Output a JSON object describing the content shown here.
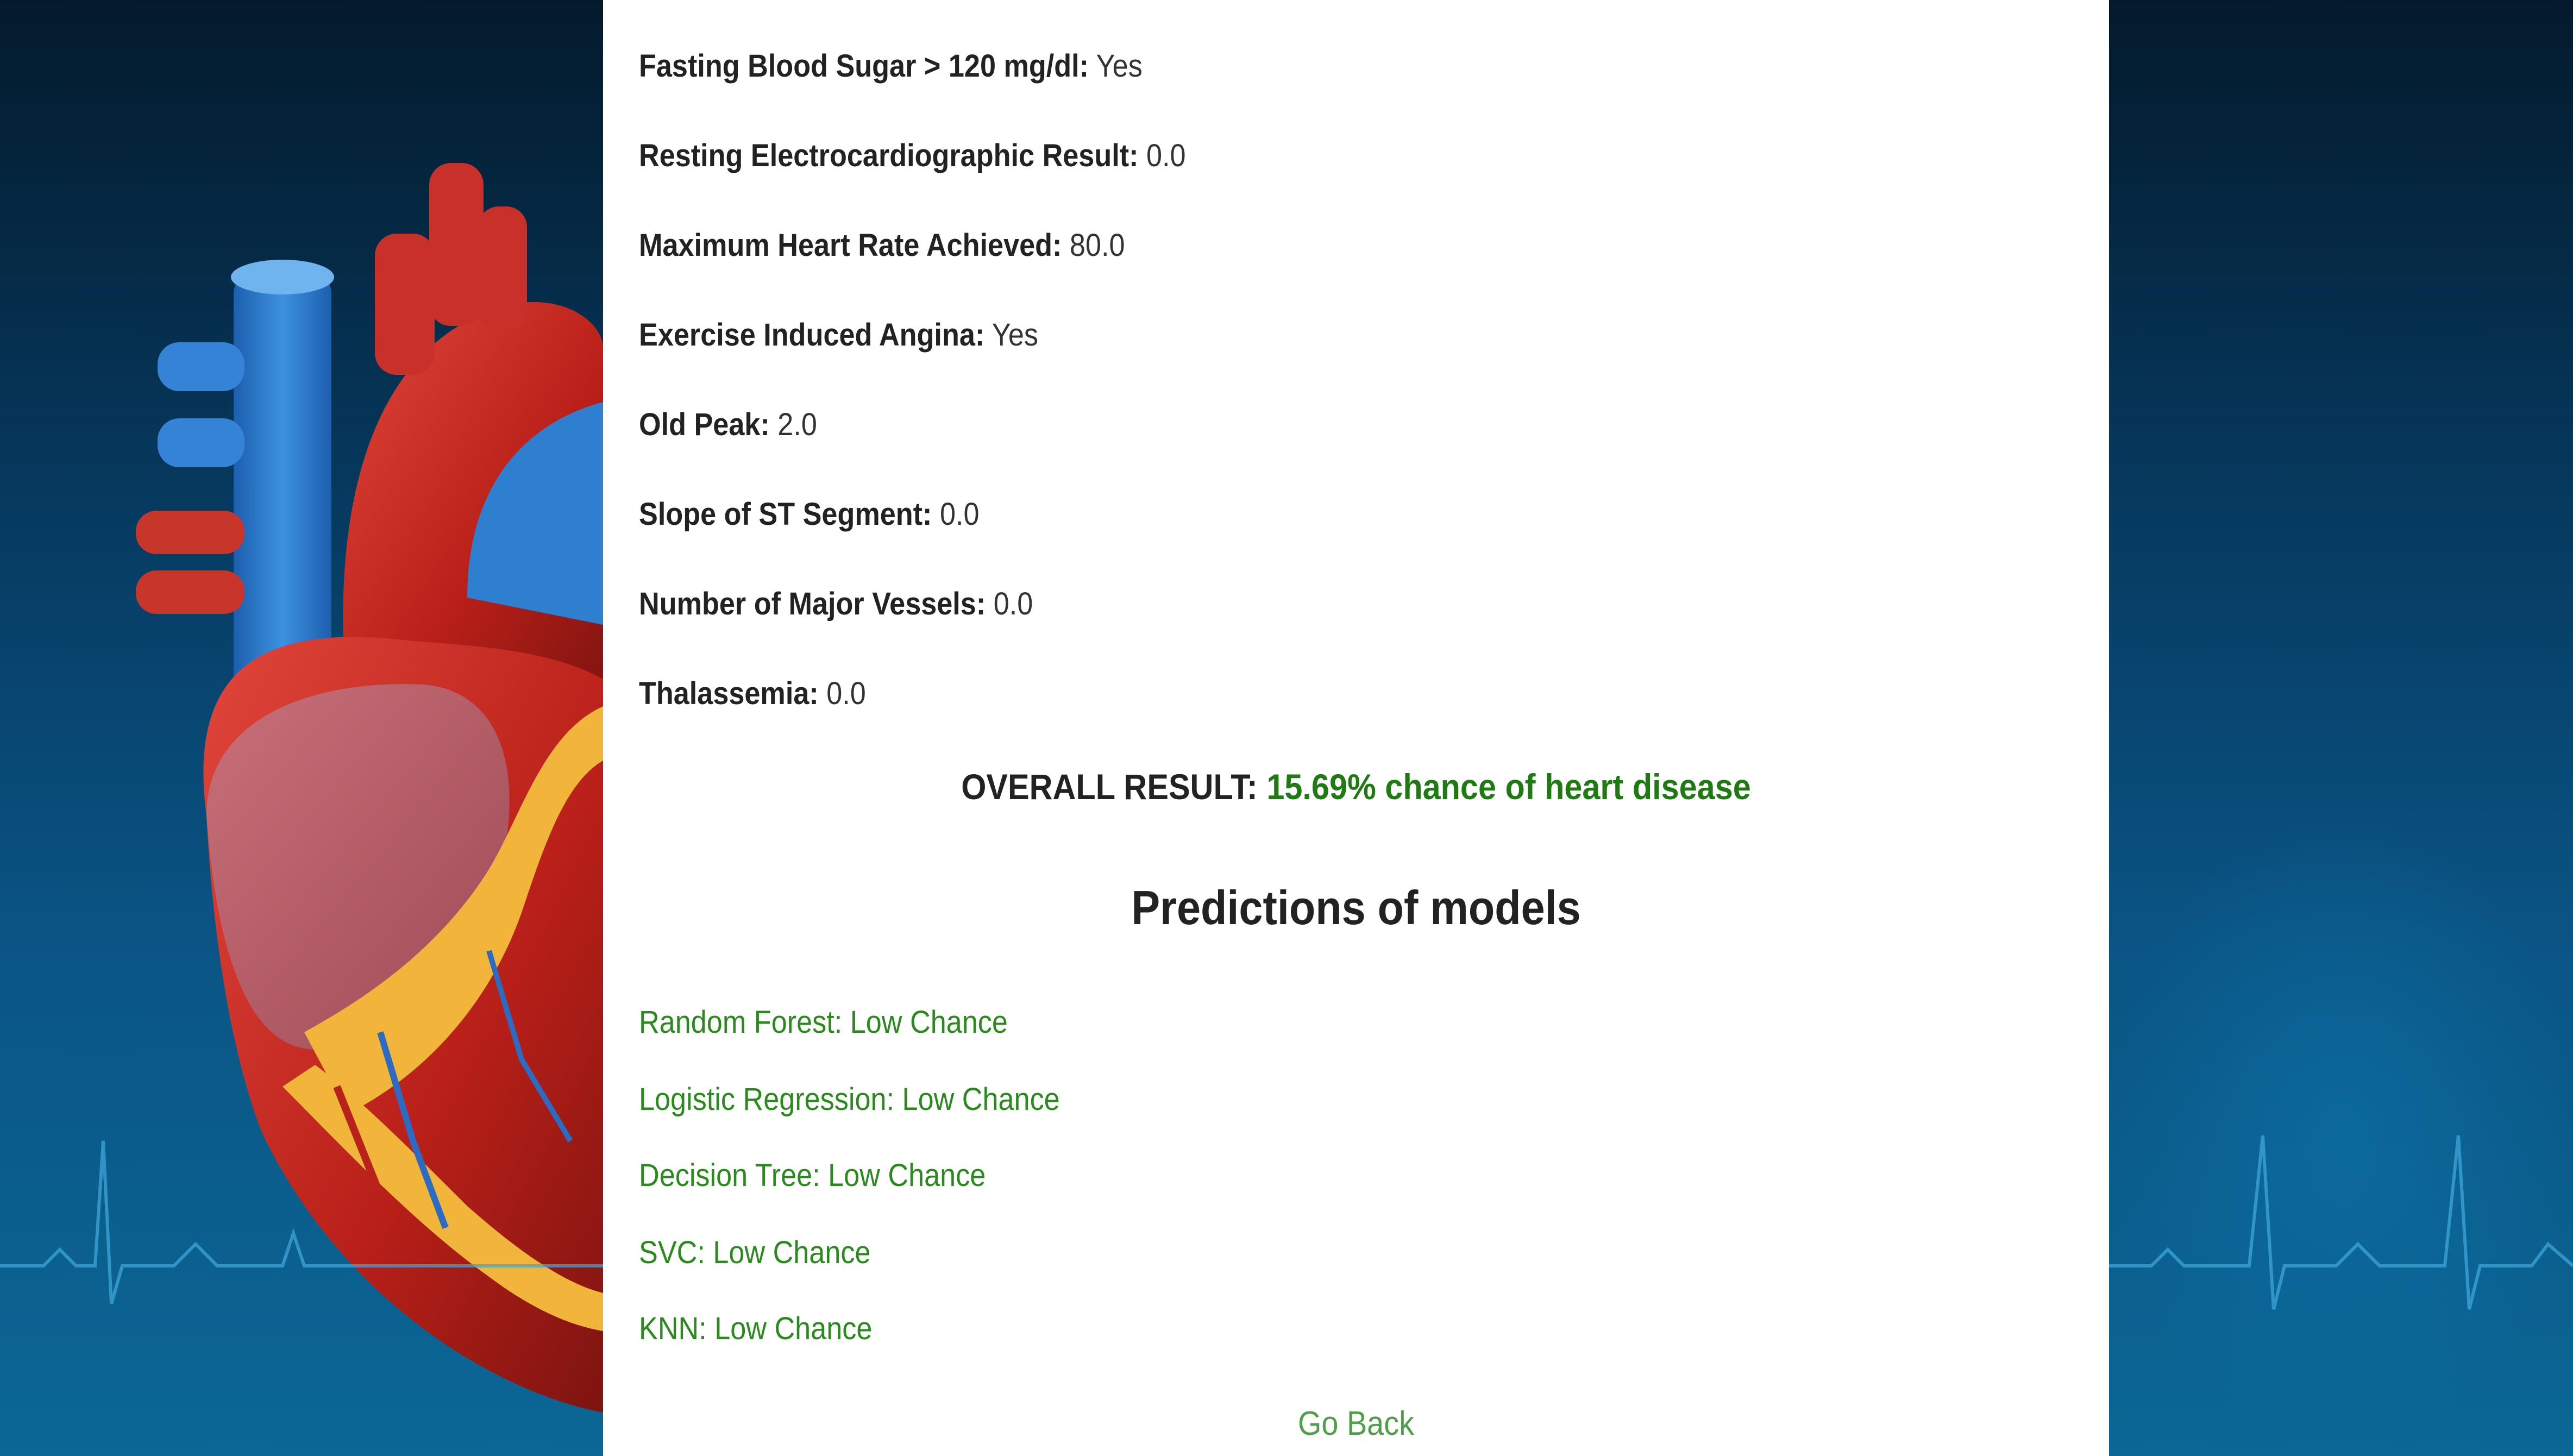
{
  "fields": [
    {
      "label": "Fasting Blood Sugar > 120 mg/dl:",
      "value": "Yes"
    },
    {
      "label": "Resting Electrocardiographic Result:",
      "value": "0.0"
    },
    {
      "label": "Maximum Heart Rate Achieved:",
      "value": "80.0"
    },
    {
      "label": "Exercise Induced Angina:",
      "value": "Yes"
    },
    {
      "label": "Old Peak:",
      "value": "2.0"
    },
    {
      "label": "Slope of ST Segment:",
      "value": "0.0"
    },
    {
      "label": "Number of Major Vessels:",
      "value": "0.0"
    },
    {
      "label": "Thalassemia:",
      "value": "0.0"
    }
  ],
  "overall": {
    "label": "OVERALL RESULT:",
    "value": "15.69% chance of heart disease"
  },
  "predictions": {
    "heading": "Predictions of models",
    "items": [
      "Random Forest: Low Chance",
      "Logistic Regression: Low Chance",
      "Decision Tree: Low Chance",
      "SVC: Low Chance",
      "KNN: Low Chance"
    ]
  },
  "go_back_label": "Go Back",
  "colors": {
    "result_green": "#1f7a14",
    "model_green": "#2a8a1e",
    "link_green": "#4f9e49",
    "background_blue": "#0a5585",
    "heart_red": "#c4261d",
    "vessel_blue": "#2f7fd0"
  }
}
